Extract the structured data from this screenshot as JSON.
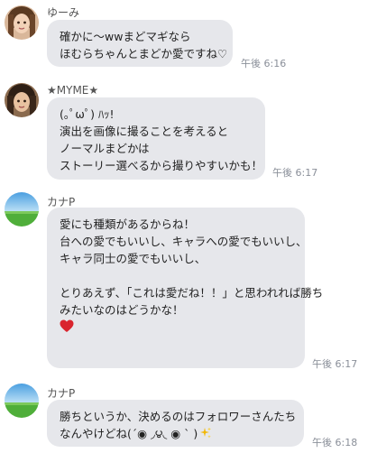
{
  "messages": [
    {
      "sender": "ゆーみ",
      "lines": [
        "確かに〜wwまどマギなら",
        "ほむらちゃんとまどか愛ですね♡"
      ],
      "time": "午後 6:16"
    },
    {
      "sender": "★MYME★",
      "lines": [
        "(｡ﾟωﾟ) ﾊｯ!",
        "演出を画像に撮ることを考えると",
        "ノーマルまどかは",
        "ストーリー選べるから撮りやすいかも！"
      ],
      "time": "午後 6:17"
    },
    {
      "sender": "カナP",
      "lines": [
        "愛にも種類があるからね！",
        "台への愛でもいいし、キャラへの愛でもいいし、",
        "キャラ同士の愛でもいいし、",
        "",
        "とりあえず、「これは愛だね！！」と思われれば勝ち",
        "みたいなのはどうかな！"
      ],
      "emoji": "red-heart",
      "time": "午後 6:17"
    },
    {
      "sender": "カナP",
      "lines": [
        "勝ちというか、決めるのはフォロワーさんたち",
        "なんやけどね(´◉ ◞౪◟ ◉ ` )"
      ],
      "emoji": "sparkles",
      "time": "午後 6:18"
    }
  ],
  "colors": {
    "bubble": "#e6e7eb",
    "time": "#8a8f99",
    "heart": "#d9252e",
    "sparkle": "#f2b705"
  }
}
